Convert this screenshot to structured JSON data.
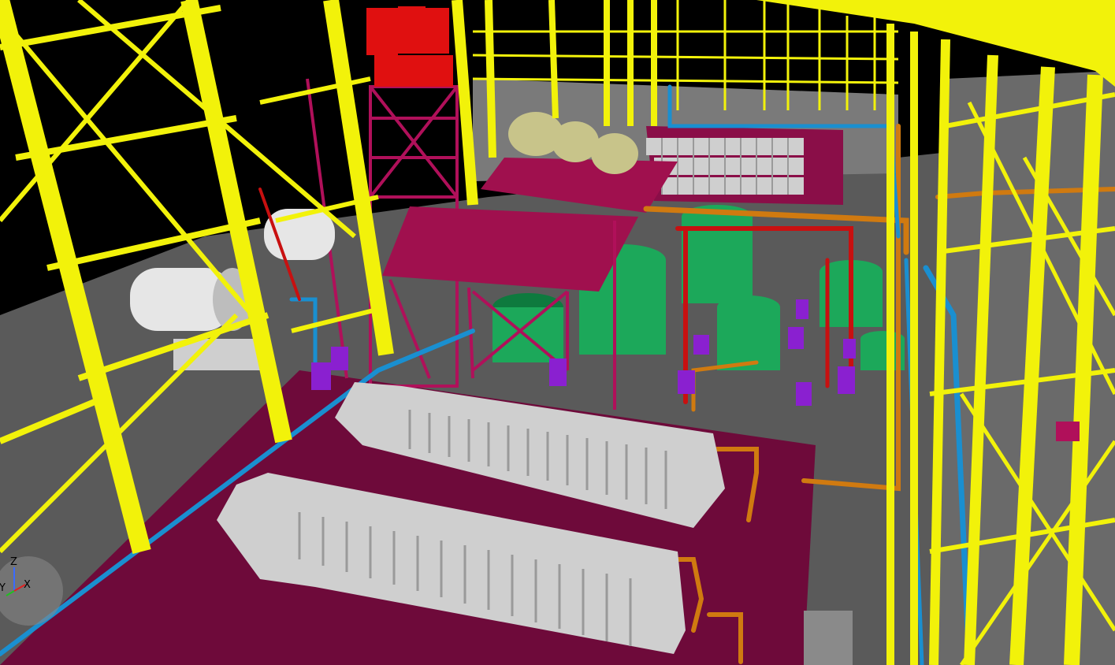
{
  "viewport": {
    "background": "#000000"
  },
  "colors": {
    "structure_yellow": "#f2f20a",
    "structure_yellow_dark": "#b8b800",
    "floor_maroon": "#6e0a3a",
    "floor_maroon_dark": "#520628",
    "platform_magenta": "#a0104e",
    "ground_gray": "#5a5a5a",
    "ground_gray_light": "#7a7a7a",
    "filter_press": "#cfcfcf",
    "filter_press_shadow": "#9a9a9a",
    "tank_green": "#1ca85a",
    "tank_green_dark": "#0e7a3e",
    "pipe_orange": "#d07a10",
    "pipe_blue": "#1a8fd0",
    "pipe_red": "#c81010",
    "pump_purple": "#8a20d0",
    "drum_white": "#e6e6e6",
    "cyclone_red": "#e01010",
    "fan_khaki": "#c8c48a"
  },
  "axis_gizmo": {
    "z_label": "Z",
    "y_label": "Y",
    "x_label": "X",
    "z_color": "#3a6aff",
    "y_color": "#20c020",
    "x_color": "#e02020"
  }
}
